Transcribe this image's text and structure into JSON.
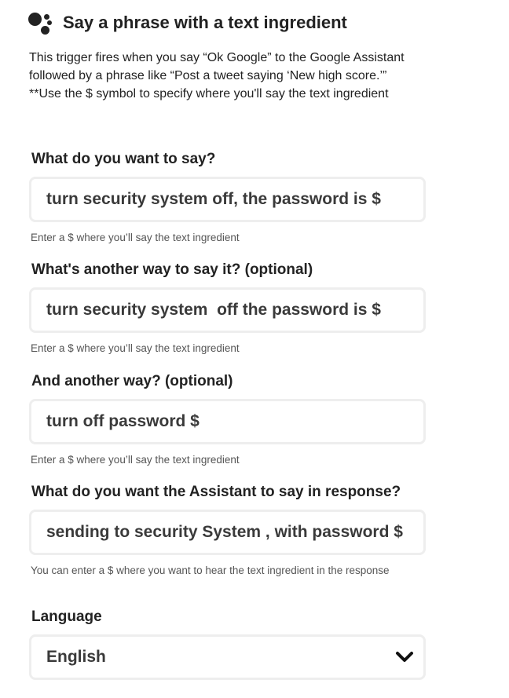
{
  "header": {
    "icon": "google-assistant-icon",
    "title": "Say a phrase with a text ingredient"
  },
  "description": "This trigger fires when you say “Ok Google” to the Google Assistant followed by a phrase like “Post a tweet saying ‘New high score.’” **Use the $ symbol to specify where you'll say the text ingredient",
  "fields": [
    {
      "label": "What do you want to say?",
      "value": "turn security system off, the password is $",
      "help": "Enter a $ where you’ll say the text ingredient"
    },
    {
      "label": "What's another way to say it? (optional)",
      "value": "turn security system  off the password is $",
      "help": "Enter a $ where you’ll say the text ingredient"
    },
    {
      "label": "And another way? (optional)",
      "value": "turn off password $",
      "help": "Enter a $ where you’ll say the text ingredient"
    },
    {
      "label": "What do you want the Assistant to say in response?",
      "value": "sending to security System , with password $",
      "help": "You can enter a $ where you want to hear the text ingredient in the response"
    }
  ],
  "language": {
    "label": "Language",
    "selected": "English",
    "icon": "chevron-down-icon"
  }
}
